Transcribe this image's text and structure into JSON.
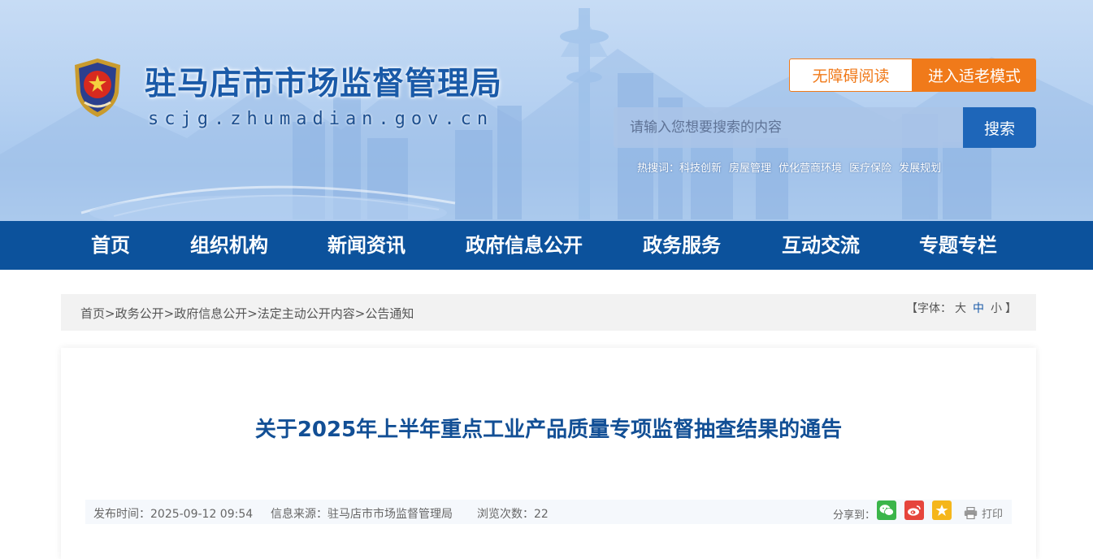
{
  "site": {
    "title": "驻马店市市场监督管理局",
    "domain": "scjg.zhumadian.gov.cn",
    "accessible_label": "无障碍阅读",
    "elder_label": "进入适老模式"
  },
  "search": {
    "placeholder": "请输入您想要搜索的内容",
    "button_label": "搜索",
    "hot_label": "热搜词：",
    "hot_words": [
      "科技创新",
      "房屋管理",
      "优化营商环境",
      "医疗保险",
      "发展规划"
    ]
  },
  "nav": [
    "首页",
    "组织机构",
    "新闻资讯",
    "政府信息公开",
    "政务服务",
    "互动交流",
    "专题专栏"
  ],
  "breadcrumb": [
    "首页",
    "政务公开",
    "政府信息公开",
    "法定主动公开内容",
    "公告通知"
  ],
  "breadcrumb_sep": ">",
  "font_size": {
    "open": "【字体：",
    "large": "大",
    "medium": "中",
    "small": "小",
    "close": "】"
  },
  "article": {
    "title": "关于2025年上半年重点工业产品质量专项监督抽查结果的通告",
    "publish_time": "发布时间：2025-09-12 09:54",
    "source": "信息来源：驻马店市市场监督管理局",
    "views": "浏览次数：22",
    "share_label": "分享到：",
    "print_label": "打印"
  },
  "colors": {
    "brand_blue": "#0c529c",
    "title_blue": "#124f95",
    "accent_orange": "#f07a1a",
    "wechat_green": "#3bb54a",
    "weibo_red": "#e6453c",
    "qzone_yellow": "#f5b61b"
  },
  "icons": [
    "national-emblem-icon",
    "wechat-icon",
    "weibo-icon",
    "qzone-star-icon",
    "printer-icon"
  ]
}
